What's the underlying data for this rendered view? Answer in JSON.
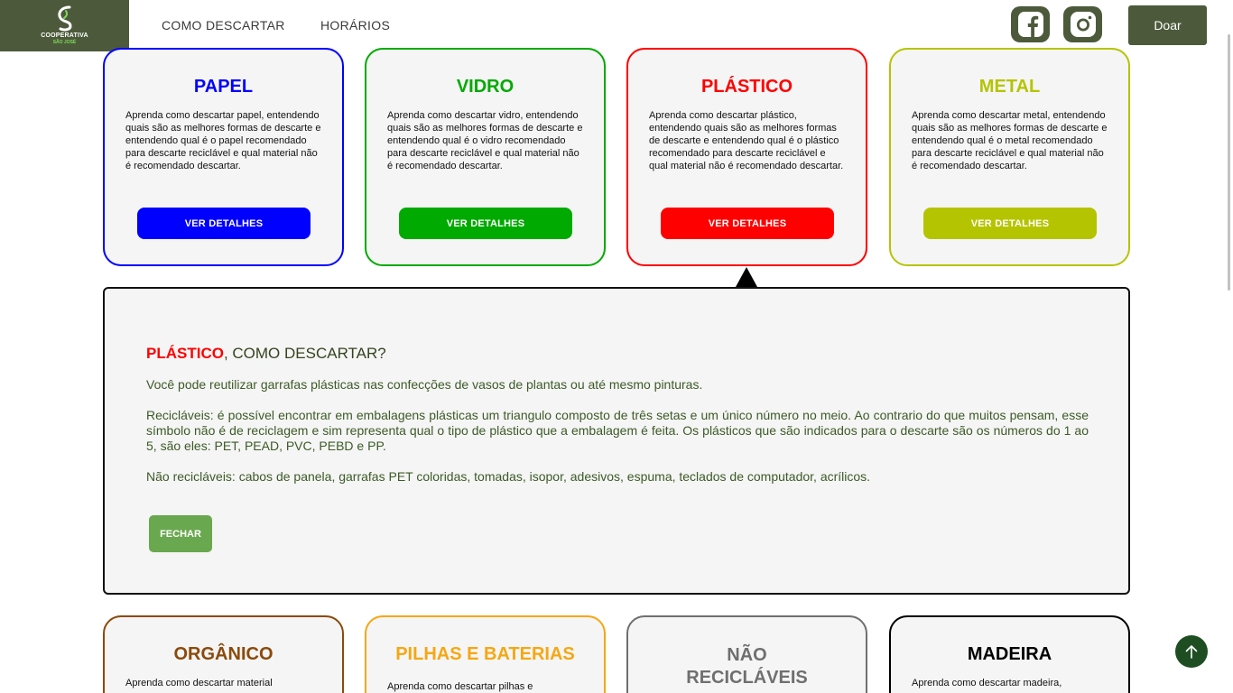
{
  "header": {
    "logo_title": "COOPERATIVA",
    "logo_sub": "SÃO JOSÉ",
    "nav": [
      "COMO DESCARTAR",
      "HORÁRIOS"
    ],
    "donate_label": "Doar",
    "social_icons": [
      "facebook-icon",
      "instagram-icon"
    ]
  },
  "cards": [
    {
      "title": "PAPEL",
      "color": "#0000ff",
      "desc": "Aprenda como descartar papel, entendendo quais são as melhores formas de descarte e entendendo qual é o papel recomendado para descarte reciclável e qual material não é recomendado descartar.",
      "button": "VER DETALHES"
    },
    {
      "title": "VIDRO",
      "color": "#00aa00",
      "desc": "Aprenda como descartar vidro, entendendo quais são as melhores formas de descarte e entendendo qual é o vidro recomendado para descarte reciclável e qual material não é recomendado descartar.",
      "button": "VER DETALHES"
    },
    {
      "title": "PLÁSTICO",
      "color": "#ff0000",
      "desc": "Aprenda como descartar plástico, entendendo quais são as melhores formas de descarte e entendendo qual é o plástico recomendado para descarte reciclável e qual material não é recomendado descartar.",
      "button": "VER DETALHES"
    },
    {
      "title": "METAL",
      "color": "#b5c400",
      "desc": "Aprenda como descartar metal, entendendo quais são as melhores formas de descarte e entendendo qual é o metal recomendado para descarte reciclável e qual material não é recomendado descartar.",
      "button": "VER DETALHES"
    },
    {
      "title": "ORGÂNICO",
      "color": "#8b4a0b",
      "desc": "Aprenda como descartar material"
    },
    {
      "title": "PILHAS E BATERIAS",
      "color": "#f5a712",
      "desc": "Aprenda como descartar pilhas e"
    },
    {
      "title": "NÃO RECICLÁVEIS",
      "color": "#6f6f6f",
      "desc": ""
    },
    {
      "title": "MADEIRA",
      "color": "#000000",
      "desc": "Aprenda como descartar madeira,"
    }
  ],
  "panel": {
    "heading_highlight": "PLÁSTICO",
    "heading_rest": ", COMO DESCARTAR?",
    "p1": "Você pode reutilizar garrafas plásticas nas confecções de vasos de plantas ou até mesmo pinturas.",
    "p2": "Recicláveis: é possível encontrar em embalagens plásticas um triangulo composto de três setas e um único número no meio. Ao contrario do que muitos pensam, esse símbolo não é de reciclagem e sim representa qual o tipo de plástico que a embalagem é feita. Os plásticos que são indicados para o descarte são os números do 1 ao 5, são eles: PET, PEAD, PVC, PEBD e PP.",
    "p3": "Não recicláveis: cabos de panela, garrafas PET coloridas, tomadas, isopor, adesivos, espuma, teclados de computador, acrílicos.",
    "close_label": "FECHAR"
  }
}
